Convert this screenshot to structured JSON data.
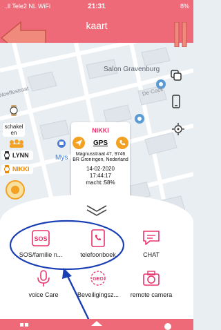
{
  "status_bar": {
    "carrier": "..ll Tele2 NL WiFi",
    "time": "21:31",
    "battery": "8%"
  },
  "header": {
    "title": "kaart"
  },
  "map": {
    "poi": "Salon Gravenburg",
    "streets": [
      "Noeffestraat",
      "De Cock"
    ],
    "partial_label": "Mys"
  },
  "devices": [
    {
      "label": "schakel en"
    },
    {
      "label": "LYNN"
    },
    {
      "label": "NIKKI"
    }
  ],
  "info_card": {
    "name": "NIKKI",
    "mode": "GPS",
    "address_line1": "Magnusstraat 47, 9746",
    "address_line2": "BR Groningen, Nederland",
    "date": "14-02-2020",
    "time": "17:44:17",
    "battery": "macht::58%"
  },
  "menu": [
    {
      "label": "SOS/familie n...",
      "icon": "sos-icon"
    },
    {
      "label": "telefoonboek",
      "icon": "phonebook-icon"
    },
    {
      "label": "CHAT",
      "icon": "chat-icon"
    },
    {
      "label": "voice Care",
      "icon": "microphone-icon"
    },
    {
      "label": "Beveiligingsz...",
      "icon": "geofence-icon"
    },
    {
      "label": "remote camera",
      "icon": "camera-icon"
    }
  ],
  "colors": {
    "brand": "#ee6a78",
    "accent_orange": "#f2a122",
    "icon_red": "#e8336b",
    "annotation_blue": "#1a3fb5"
  }
}
